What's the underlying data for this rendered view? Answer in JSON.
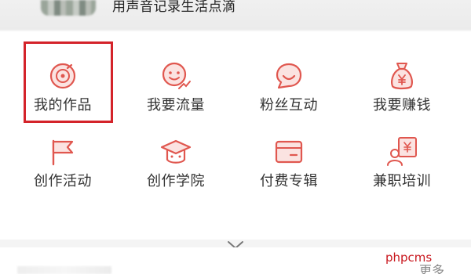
{
  "header": {
    "slogan": "用声音记录生活点滴"
  },
  "grid": {
    "items": [
      {
        "label": "我的作品",
        "icon": "record-disc-icon",
        "highlighted": true
      },
      {
        "label": "我要流量",
        "icon": "smile-growth-icon"
      },
      {
        "label": "粉丝互动",
        "icon": "chat-bubble-icon"
      },
      {
        "label": "我要赚钱",
        "icon": "money-bag-icon"
      },
      {
        "label": "创作活动",
        "icon": "flag-icon"
      },
      {
        "label": "创作学院",
        "icon": "graduation-cap-icon"
      },
      {
        "label": "付费专辑",
        "icon": "card-icon"
      },
      {
        "label": "兼职培训",
        "icon": "user-yen-icon"
      }
    ],
    "expand_icon": "chevron-down-icon"
  },
  "bottom": {
    "more_label": "更多"
  },
  "watermark": "phpcms",
  "colors": {
    "icon_accent": "#e0574f",
    "highlight_border": "#d4232a",
    "watermark": "#c8161d"
  }
}
